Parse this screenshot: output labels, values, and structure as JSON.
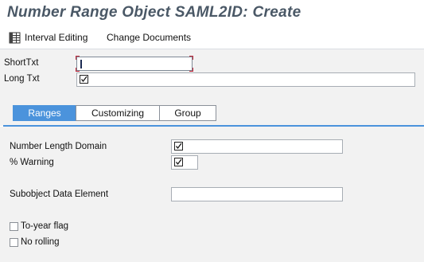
{
  "window": {
    "title": "Number Range Object SAML2ID: Create"
  },
  "toolbar": {
    "interval_editing_label": "Interval Editing",
    "change_documents_label": "Change Documents"
  },
  "header": {
    "short_txt_label": "ShortTxt",
    "short_txt_value": "",
    "long_txt_label": "Long Txt",
    "long_txt_value": ""
  },
  "tabs": [
    {
      "label": "Ranges",
      "active": true
    },
    {
      "label": "Customizing",
      "active": false
    },
    {
      "label": "Group",
      "active": false
    }
  ],
  "ranges": {
    "number_length_domain_label": "Number Length Domain",
    "number_length_domain_value": "",
    "warning_label": "% Warning",
    "warning_value": "",
    "subobject_data_element_label": "Subobject Data Element",
    "subobject_data_element_value": "",
    "to_year_flag_label": "To-year flag",
    "to_year_flag_checked": false,
    "no_rolling_label": "No rolling",
    "no_rolling_checked": false
  },
  "colors": {
    "title": "#4a5866",
    "tab_active": "#4b93dc",
    "focus": "#c0283b",
    "panel_bg": "#f2f2f2"
  },
  "icons": {
    "interval_editing": "table-grid-icon",
    "required_field": "checkbox-required-icon"
  }
}
